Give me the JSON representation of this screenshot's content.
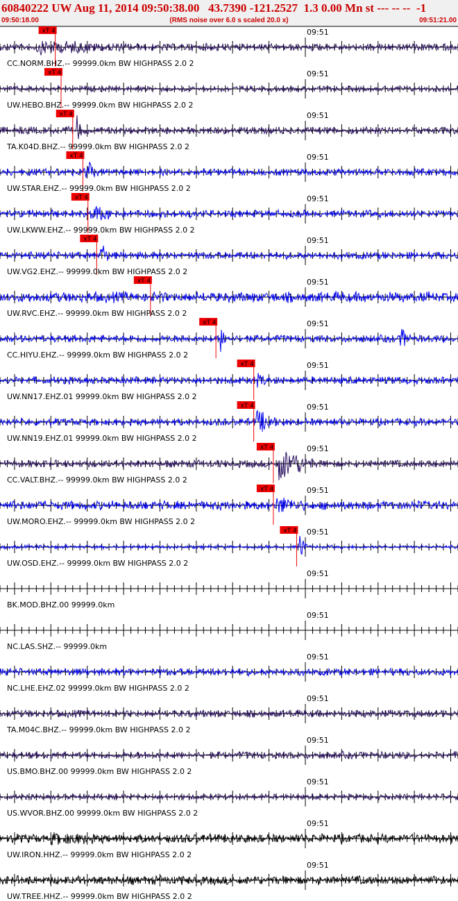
{
  "header": {
    "title": "60840222 UW Aug 11, 2014 09:50:38.00   43.7390 -121.2527  1.3 0.00 Mn st --- -- --  -1",
    "start_time": "09:50:18.00",
    "note": "(RMS noise over 6.0 s scaled 20.0 x)",
    "end_time": "09:51:21.00"
  },
  "axis": {
    "minute_label": "09:51",
    "start_s": 18.0,
    "end_s": 81.0,
    "minute_s": 60.0
  },
  "pick_label": "xT 4",
  "colors": {
    "blue": "#0000ee",
    "navy": "#2a1060",
    "black": "#000000",
    "red": "#ee0000"
  },
  "traces": [
    {
      "label": "CC.NORM.BHZ.-- 99999.0km BW  HIGHPASS  2.0  2",
      "color": "navy",
      "amp": 4,
      "pick_s": 25.6,
      "events": [
        {
          "t": 23,
          "dur": 14,
          "amp": 6
        }
      ]
    },
    {
      "label": "UW.HEBO.BHZ.-- 99999.0km BW  HIGHPASS  2.0  2",
      "color": "navy",
      "amp": 3,
      "pick_s": 26.4,
      "events": []
    },
    {
      "label": "TA.K04D.BHZ.-- 99999.0km BW  HIGHPASS  2.0  2",
      "color": "navy",
      "amp": 4,
      "pick_s": 28.0,
      "events": [
        {
          "t": 28.5,
          "dur": 0.8,
          "amp": 20
        }
      ]
    },
    {
      "label": "UW.STAR.EHZ.-- 99999.0km BW  HIGHPASS  2.0  2",
      "color": "blue",
      "amp": 4,
      "pick_s": 29.4,
      "events": [
        {
          "t": 29.8,
          "dur": 1.2,
          "amp": 20
        }
      ]
    },
    {
      "label": "UW.LKWW.EHZ.-- 99999.0km BW  HIGHPASS  2.0  2",
      "color": "blue",
      "amp": 4,
      "pick_s": 30.1,
      "events": [
        {
          "t": 30.5,
          "dur": 3.5,
          "amp": 10
        },
        {
          "t": 24.5,
          "dur": 0.8,
          "amp": 6
        }
      ]
    },
    {
      "label": "UW.VG2.EHZ.-- 99999.0km BW  HIGHPASS  2.0  2",
      "color": "blue",
      "amp": 4,
      "pick_s": 31.3,
      "events": [
        {
          "t": 31.8,
          "dur": 1.0,
          "amp": 20
        }
      ]
    },
    {
      "label": "UW.RVC.EHZ.-- 99999.0km BW  HIGHPASS  2.0  2",
      "color": "blue",
      "amp": 6,
      "pick_s": 38.7,
      "events": []
    },
    {
      "label": "CC.HIYU.EHZ.-- 99999.0km BW  HIGHPASS  2.0  2",
      "color": "blue",
      "amp": 4,
      "pick_s": 47.7,
      "events": [
        {
          "t": 48.3,
          "dur": 1.2,
          "amp": 18
        },
        {
          "t": 51.7,
          "dur": 0.5,
          "amp": 10
        },
        {
          "t": 73,
          "dur": 1.5,
          "amp": 15
        }
      ]
    },
    {
      "label": "UW.NN17.EHZ.01 99999.0km BW  HIGHPASS  2.0  2",
      "color": "blue",
      "amp": 4,
      "pick_s": 52.9,
      "events": [
        {
          "t": 53.4,
          "dur": 1.5,
          "amp": 8
        }
      ]
    },
    {
      "label": "UW.NN19.EHZ.01 99999.0km BW  HIGHPASS  2.0  2",
      "color": "blue",
      "amp": 4,
      "pick_s": 52.9,
      "events": [
        {
          "t": 53.3,
          "dur": 3.0,
          "amp": 14
        }
      ]
    },
    {
      "label": "CC.VALT.BHZ.-- 99999.0km BW  HIGHPASS  2.0  2",
      "color": "navy",
      "amp": 4,
      "pick_s": 55.6,
      "events": [
        {
          "t": 56.2,
          "dur": 5.0,
          "amp": 22
        }
      ]
    },
    {
      "label": "UW.MORO.EHZ.-- 99999.0km BW  HIGHPASS  2.0  2",
      "color": "blue",
      "amp": 5,
      "pick_s": 55.6,
      "events": [
        {
          "t": 56.0,
          "dur": 3.5,
          "amp": 10
        }
      ]
    },
    {
      "label": "UW.OSD.EHZ.-- 99999.0km BW  HIGHPASS  2.0  2",
      "color": "blue",
      "amp": 2,
      "pick_s": 58.8,
      "events": [
        {
          "t": 59.2,
          "dur": 1.0,
          "amp": 20
        }
      ]
    },
    {
      "label": "BK.MOD.BHZ.00 99999.0km",
      "color": "blue",
      "amp": 0,
      "pick_s": null,
      "events": []
    },
    {
      "label": "NC.LAS.SHZ.-- 99999.0km",
      "color": "blue",
      "amp": 0,
      "pick_s": null,
      "events": []
    },
    {
      "label": "NC.LHE.EHZ.02 99999.0km BW  HIGHPASS  2.0  2",
      "color": "blue",
      "amp": 4,
      "pick_s": null,
      "events": []
    },
    {
      "label": "TA.M04C.BHZ.-- 99999.0km BW  HIGHPASS  2.0  2",
      "color": "navy",
      "amp": 4,
      "pick_s": null,
      "events": []
    },
    {
      "label": "US.BMO.BHZ.00 99999.0km BW  HIGHPASS  2.0  2",
      "color": "navy",
      "amp": 4,
      "pick_s": null,
      "events": []
    },
    {
      "label": "US.WVOR.BHZ.00 99999.0km BW  HIGHPASS  2.0  2",
      "color": "navy",
      "amp": 3,
      "pick_s": null,
      "events": []
    },
    {
      "label": "UW.IRON.HHZ.-- 99999.0km BW  HIGHPASS  2.0  2",
      "color": "black",
      "amp": 5,
      "pick_s": null,
      "events": [
        {
          "t": 25,
          "dur": 8,
          "amp": 4
        },
        {
          "t": 49.5,
          "dur": 0.8,
          "amp": 8
        }
      ]
    },
    {
      "label": "UW.TREE.HHZ.-- 99999.0km BW  HIGHPASS  2.0  2",
      "color": "black",
      "amp": 5,
      "pick_s": null,
      "events": []
    }
  ]
}
